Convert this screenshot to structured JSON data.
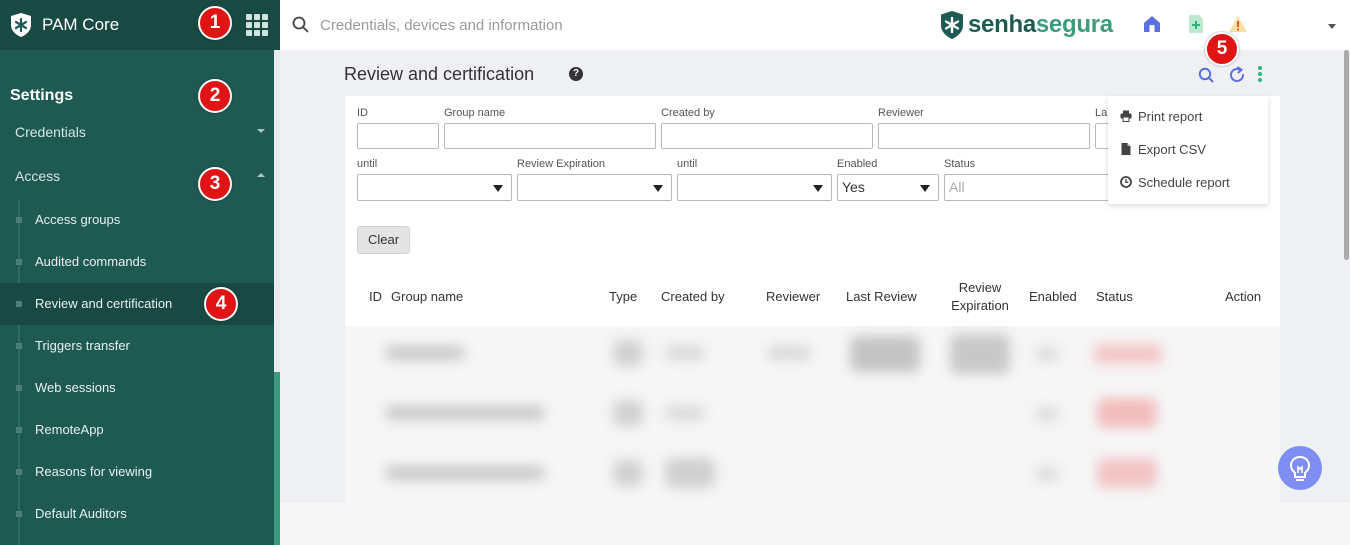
{
  "sidebar": {
    "app_title": "PAM Core",
    "section_title": "Settings",
    "groups": [
      {
        "label": "Credentials",
        "expanded": false
      },
      {
        "label": "Access",
        "expanded": true
      }
    ],
    "items": [
      {
        "label": "Access groups",
        "active": false
      },
      {
        "label": "Audited commands",
        "active": false
      },
      {
        "label": "Review and certification",
        "active": true
      },
      {
        "label": "Triggers transfer",
        "active": false
      },
      {
        "label": "Web sessions",
        "active": false
      },
      {
        "label": "RemoteApp",
        "active": false
      },
      {
        "label": "Reasons for viewing",
        "active": false
      },
      {
        "label": "Default Auditors",
        "active": false
      }
    ]
  },
  "topbar": {
    "search_placeholder": "Credentials, devices and information",
    "brand_part1": "senha",
    "brand_part2": "segura"
  },
  "page": {
    "title": "Review and certification"
  },
  "filters": {
    "id": "ID",
    "group_name": "Group name",
    "created_by": "Created by",
    "reviewer": "Reviewer",
    "last_review_partial": "La",
    "until1": "until",
    "review_expiration": "Review Expiration",
    "until2": "until",
    "enabled": "Enabled",
    "enabled_value": "Yes",
    "status": "Status",
    "status_placeholder": "All",
    "clear_label": "Clear"
  },
  "table": {
    "headers": [
      "ID",
      "Group name",
      "Type",
      "Created by",
      "Reviewer",
      "Last Review",
      "Review Expiration",
      "Enabled",
      "Status",
      "Action"
    ]
  },
  "dropdown": {
    "items": [
      "Print report",
      "Export CSV",
      "Schedule report"
    ]
  },
  "markers": [
    "1",
    "2",
    "3",
    "4",
    "5"
  ],
  "colors": {
    "sidebar": "#1f5a52",
    "sidebar_dark": "#184a43",
    "accent_green": "#3d9b7d",
    "marker_red": "#e01414"
  }
}
